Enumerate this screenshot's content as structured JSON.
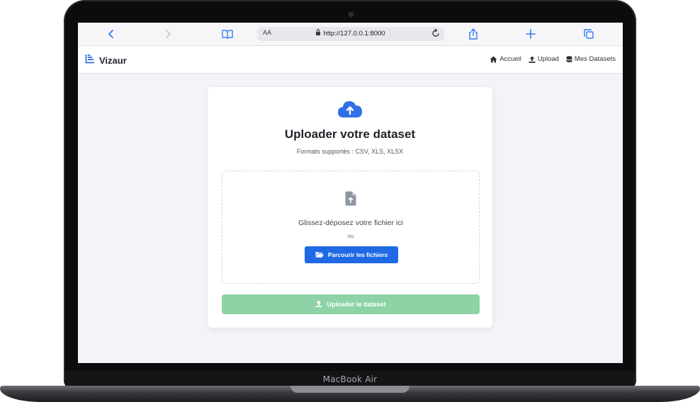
{
  "device": {
    "model_label": "MacBook Air"
  },
  "browser": {
    "url": "http://127.0.0.1:8000",
    "reader_label": "AA",
    "icons": [
      "back-icon",
      "forward-icon",
      "bookmarks-icon",
      "lock-icon",
      "reload-icon",
      "share-icon",
      "new-tab-icon",
      "tabs-icon"
    ]
  },
  "navbar": {
    "brand": "Vizaur",
    "links": [
      {
        "label": "Accueil",
        "icon": "home-icon"
      },
      {
        "label": "Upload",
        "icon": "upload-icon"
      },
      {
        "label": "Mes Datasets",
        "icon": "database-icon"
      }
    ]
  },
  "card": {
    "title": "Uploader votre dataset",
    "subtitle": "Formats supportés : CSV, XLS, XLSX",
    "dropzone": {
      "text": "Glissez-déposez votre fichier ici",
      "or": "ou",
      "browse_label": "Parcourir les fichiers"
    },
    "submit_label": "Uploader le dataset"
  },
  "colors": {
    "accent": "#1f6ae4",
    "cloud_icon": "#2f6fe8",
    "submit_disabled": "#8dd3a6",
    "page_bg": "#f3f4f7"
  }
}
